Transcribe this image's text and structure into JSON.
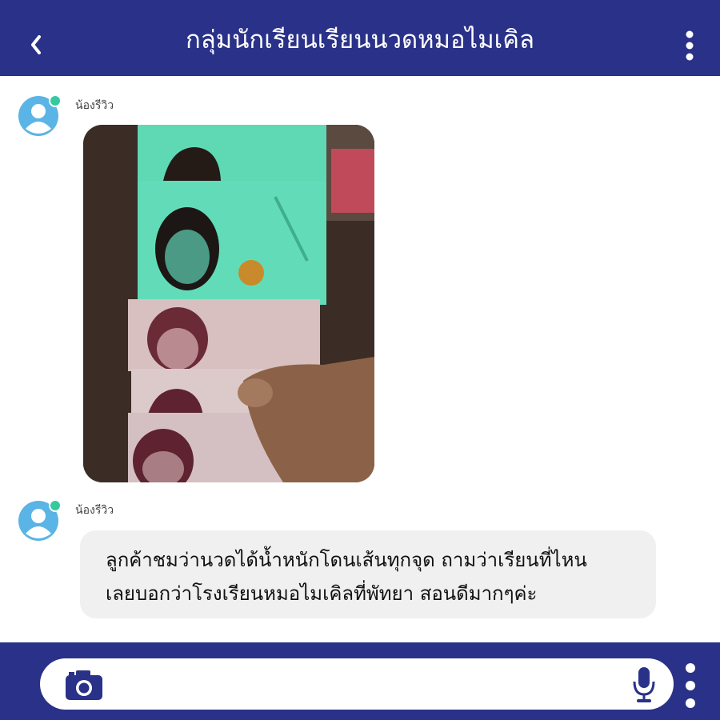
{
  "header": {
    "title": "กลุ่มนักเรียนเรียนนวดหมอไมเคิล"
  },
  "messages": [
    {
      "sender": "น้องรีวิว",
      "type": "image",
      "image_desc": "banknotes"
    },
    {
      "sender": "น้องรีวิว",
      "type": "text",
      "lines": [
        "ลูกค้าชมว่านวดได้น้ำหนักโดนเส้นทุกจุด ถามว่าเรียนที่ไหน",
        "เลยบอกว่าโรงเรียนหมอไมเคิลที่พัทยา สอนดีมากๆค่ะ"
      ]
    }
  ],
  "icons": {
    "back": "back-chevron-icon",
    "menu": "more-vertical-icon",
    "camera": "camera-icon",
    "mic": "microphone-icon",
    "avatar": "user-avatar-icon"
  },
  "colors": {
    "brand": "#2a3188",
    "online": "#36c9a0",
    "avatar": "#5ab4e5",
    "bubble": "#f0f0f0"
  }
}
